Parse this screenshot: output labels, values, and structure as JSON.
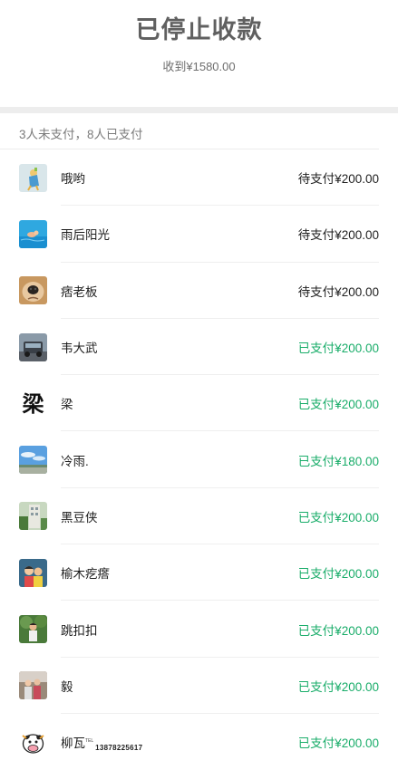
{
  "header": {
    "title": "已停止收款",
    "subtitle": "收到¥1580.00"
  },
  "summary": "3人未支付，8人已支付",
  "colors": {
    "paid": "#1aad6a",
    "unpaid": "#222222",
    "title": "#606060"
  },
  "rows": [
    {
      "name": "哦哟",
      "status": "待支付¥200.00",
      "state": "unpaid",
      "avatar": "cartoon-figure-avatar"
    },
    {
      "name": "雨后阳光",
      "status": "待支付¥200.00",
      "state": "unpaid",
      "avatar": "swimming-pool-avatar"
    },
    {
      "name": "痞老板",
      "status": "待支付¥200.00",
      "state": "unpaid",
      "avatar": "dog-nose-avatar"
    },
    {
      "name": "韦大武",
      "status": "已支付¥200.00",
      "state": "paid",
      "avatar": "car-avatar"
    },
    {
      "name": "梁",
      "status": "已支付¥200.00",
      "state": "paid",
      "avatar": "calligraphy-character-avatar",
      "avatar_text": "梁"
    },
    {
      "name": "冷雨.",
      "status": "已支付¥180.00",
      "state": "paid",
      "avatar": "sky-landscape-avatar"
    },
    {
      "name": "黑豆侠",
      "status": "已支付¥200.00",
      "state": "paid",
      "avatar": "building-avatar"
    },
    {
      "name": "榆木疙瘩",
      "status": "已支付¥200.00",
      "state": "paid",
      "avatar": "cartoon-kids-avatar"
    },
    {
      "name": "跳扣扣",
      "status": "已支付¥200.00",
      "state": "paid",
      "avatar": "person-in-park-avatar"
    },
    {
      "name": "毅",
      "status": "已支付¥200.00",
      "state": "paid",
      "avatar": "family-photo-avatar"
    },
    {
      "name": "柳瓦",
      "name_sup": "TEL",
      "name_phone": "13878225617",
      "status": "已支付¥200.00",
      "state": "paid",
      "avatar": "cow-cartoon-avatar"
    }
  ]
}
